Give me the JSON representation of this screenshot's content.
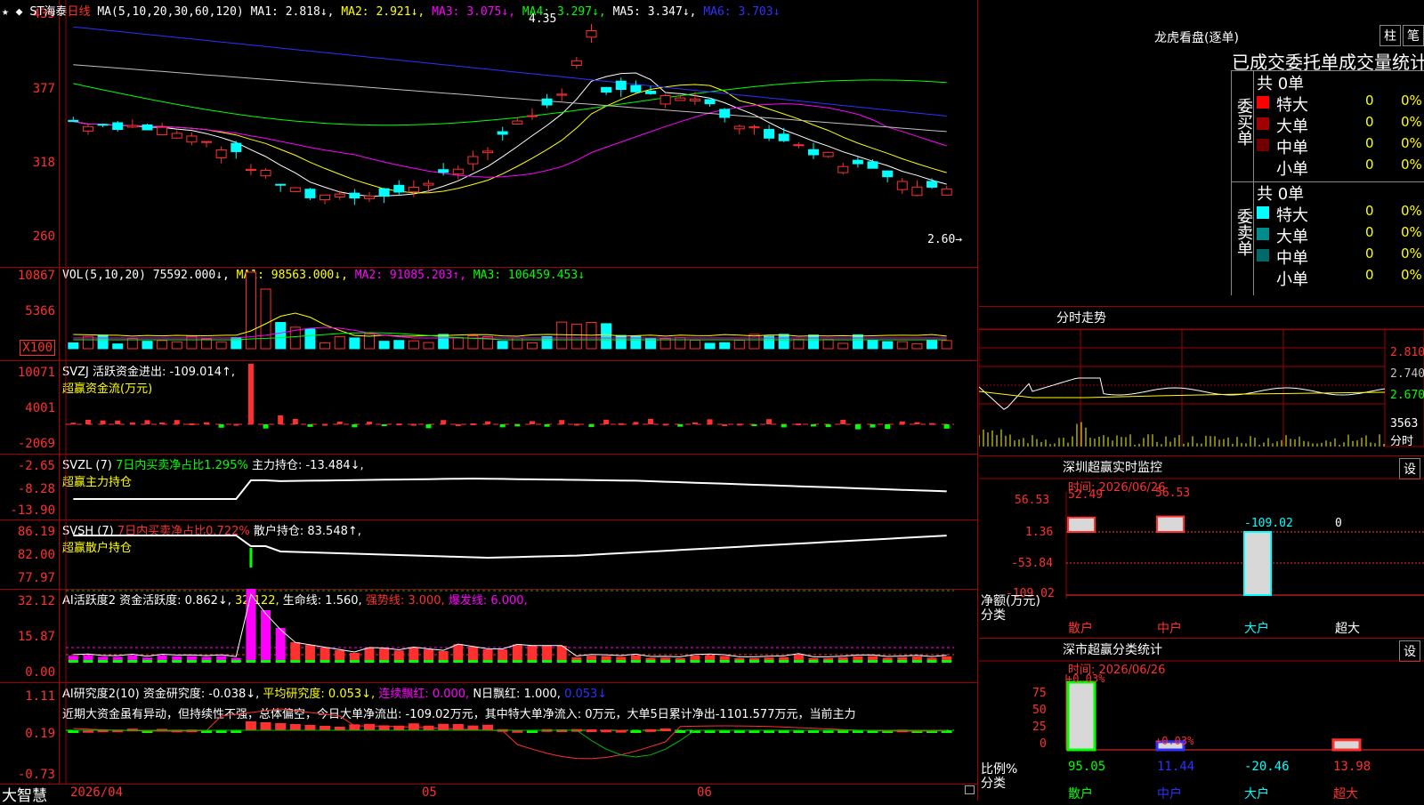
{
  "main": {
    "star_icon": "★",
    "title": "ST海泰",
    "period": "日线",
    "ma_label": "MA(5,10,20,30,60,120)",
    "ma1": "MA1: 2.818↓,",
    "ma2": "MA2: 2.921↓,",
    "ma3": "MA3: 3.075↓,",
    "ma4": "MA4: 3.297↓,",
    "ma5": "MA5: 3.347↓,",
    "ma6": "MA6: 3.703↓",
    "y_labels": [
      "435",
      "377",
      "318",
      "260"
    ],
    "high_label": "4.35",
    "low_label": "2.60→"
  },
  "vol": {
    "title": "VOL(5,10,20)",
    "value": "75592.000↓,",
    "ma1": "MA1: 98563.000↓,",
    "ma2": "MA2: 91085.203↑,",
    "ma3": "MA3: 106459.453↓",
    "y_labels": [
      "10867",
      "5366",
      "X100"
    ]
  },
  "svzj": {
    "title": "SVZJ  活跃资金进出: -109.014↑,",
    "subtitle": "超赢资金流(万元)",
    "y_labels": [
      "10071",
      "4001",
      "-2069"
    ]
  },
  "svzl": {
    "title": "SVZL (7)",
    "stat": "7日内买卖净占比1.295%",
    "stat2": "主力持仓: -13.484↓,",
    "subtitle": "超赢主力持仓",
    "y_labels": [
      "-2.65",
      "-8.28",
      "-13.90"
    ]
  },
  "svsh": {
    "title": "SVSH (7)",
    "stat": "7日内买卖净占比0.722%",
    "stat2": "散户持仓: 83.548↑,",
    "subtitle": "超赢散户持仓",
    "y_labels": [
      "86.19",
      "82.00",
      "77.97"
    ]
  },
  "ai_act": {
    "title": "AI活跃度2 资金活跃度: 0.862↓,",
    "v2": "32.122,",
    "v3": "生命线: 1.560,",
    "v4": "强势线: 3.000,",
    "v5": "爆发线: 6.000,",
    "y_labels": [
      "32.12",
      "15.87",
      "0.00"
    ]
  },
  "ai_res": {
    "title": "AI研究度2(10) 资金研究度: -0.038↓,",
    "v2": "平均研究度: 0.053↓,",
    "v3": "连续飘红: 0.000,",
    "v4": "N日飘红: 1.000,",
    "v5": "0.053↓",
    "comment": "近期大资金虽有异动，但持续性不强，总体偏空，今日大单净流出: -109.02万元，其中特大单净流入: 0万元，大单5日累计净出-1101.577万元，当前主力",
    "y_labels": [
      "1.11",
      "0.19",
      "-0.73"
    ]
  },
  "xaxis": {
    "app_name": "大智慧",
    "d1": "2026/04",
    "d2": "05",
    "d3": "06"
  },
  "lhb": {
    "title": "龙虎看盘(逐单)",
    "btn1": "柱",
    "btn2": "笔",
    "header": "已成交委托单成交量统计",
    "buy_label": "委买单",
    "sell_label": "委卖单",
    "buy_total": "共 0单",
    "sell_total": "共 0单",
    "buy_rows": [
      {
        "name": "特大",
        "val": "0",
        "pct": "0%",
        "color": "#ff0000"
      },
      {
        "name": "大单",
        "val": "0",
        "pct": "0%",
        "color": "#a00000"
      },
      {
        "name": "中单",
        "val": "0",
        "pct": "0%",
        "color": "#700000"
      },
      {
        "name": "小单",
        "val": "0",
        "pct": "0%",
        "color": "#000000"
      }
    ],
    "sell_rows": [
      {
        "name": "特大",
        "val": "0",
        "pct": "0%",
        "color": "#00ffff"
      },
      {
        "name": "大单",
        "val": "0",
        "pct": "0%",
        "color": "#008c8c"
      },
      {
        "name": "中单",
        "val": "0",
        "pct": "0%",
        "color": "#006a6a"
      },
      {
        "name": "小单",
        "val": "0",
        "pct": "0%",
        "color": "#000000"
      }
    ]
  },
  "intraday": {
    "title": "分时走势",
    "y_labels": [
      "2.810",
      "2.740",
      "2.670",
      "3563",
      "分时"
    ]
  },
  "sz_monitor": {
    "title": "深圳超赢实时监控",
    "btn": "设",
    "date": "时间: 2026/06/26",
    "y_labels": [
      "56.53",
      "1.36",
      "-53.84",
      "-109.02"
    ],
    "ylabel": "净额(万元)",
    "xlabel": "分类",
    "categories": [
      "散户",
      "中户",
      "大户",
      "超大"
    ],
    "values_text": [
      "52.49",
      "56.53",
      "-109.02",
      "0"
    ],
    "values": [
      52.49,
      56.53,
      -109.02,
      0
    ]
  },
  "sz_class": {
    "title": "深市超赢分类统计",
    "btn": "设",
    "date": "时间: 2026/06/26",
    "y_labels": [
      "75",
      "50",
      "25",
      "0"
    ],
    "ylabel": "比例%",
    "xlabel": "分类",
    "categories": [
      "散户",
      "中户",
      "大户",
      "超大"
    ],
    "top_labels": [
      "+0.03%",
      "+0.03%"
    ],
    "values_text": [
      "95.05",
      "11.44",
      "-20.46",
      "13.98"
    ],
    "values": [
      95.05,
      11.44,
      -20.46,
      13.98
    ]
  },
  "colors": {
    "up": "#ff3030",
    "down": "#00ffff",
    "border": "#a00000",
    "ma1": "#ffffff",
    "ma2": "#ffff00",
    "ma3": "#ff00ff",
    "ma4": "#00ff00",
    "ma5": "#c0c0c0",
    "ma6": "#3030ff"
  }
}
